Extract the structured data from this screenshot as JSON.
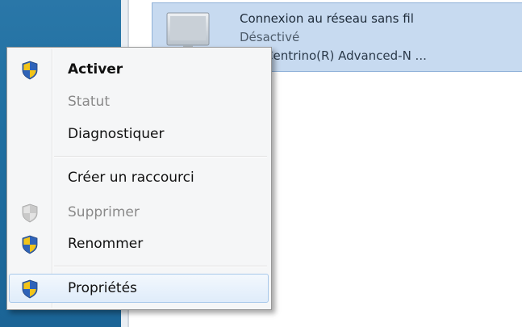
{
  "network": {
    "title": "Connexion au réseau sans fil",
    "status": "Désactivé",
    "adapter": "l(R) Centrino(R) Advanced-N ...",
    "icon": "wireless-computer-icon"
  },
  "context_menu": {
    "items": [
      {
        "label": "Activer",
        "bold": true,
        "shield": true,
        "disabled": false
      },
      {
        "label": "Statut",
        "bold": false,
        "shield": false,
        "disabled": true
      },
      {
        "label": "Diagnostiquer",
        "bold": false,
        "shield": false,
        "disabled": false
      },
      {
        "label": "Créer un raccourci",
        "bold": false,
        "shield": false,
        "disabled": false
      },
      {
        "label": "Supprimer",
        "bold": false,
        "shield": true,
        "disabled": true
      },
      {
        "label": "Renommer",
        "bold": false,
        "shield": true,
        "disabled": false
      },
      {
        "label": "Propriétés",
        "bold": false,
        "shield": true,
        "disabled": false,
        "hover": true
      }
    ]
  },
  "colors": {
    "left_panel": "#1f6fa1",
    "selection": "#c7daf0",
    "shield_blue": "#2f63b8",
    "shield_yellow": "#f2c419"
  }
}
